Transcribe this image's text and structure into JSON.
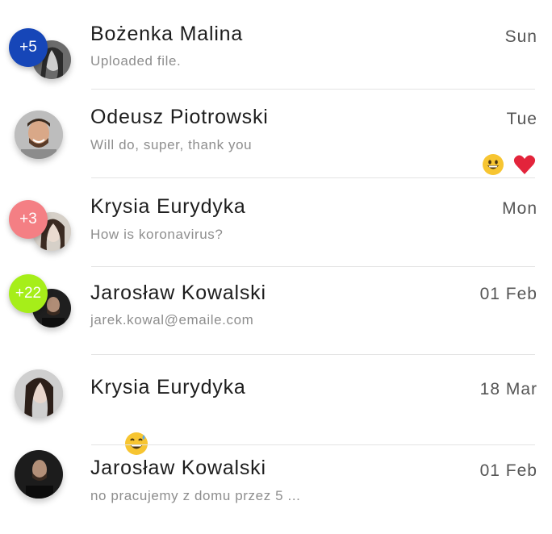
{
  "conversations": [
    {
      "name": "Bożenka Malina",
      "preview": "Uploaded file.",
      "time": "Sun",
      "badge": "+5",
      "badge_color": "#1646b8",
      "avatar": "woman-profile-avatar"
    },
    {
      "name": "Odeusz Piotrowski",
      "preview": "Will do, super, thank you",
      "time": "Tue",
      "avatar": "smiling-man-avatar",
      "reactions": [
        "grinning-face-emoji",
        "red-heart-icon"
      ]
    },
    {
      "name": "Krysia Eurydyka",
      "preview": "How is koronavirus?",
      "time": "Mon",
      "badge": "+3",
      "badge_color": "#f47f84",
      "avatar": "woman-avatar"
    },
    {
      "name": "Jarosław Kowalski",
      "preview": "jarek.kowal@emaile.com",
      "time": "01 Feb",
      "badge": "+22",
      "badge_color": "#a6ee19",
      "avatar": "man-dark-avatar"
    },
    {
      "name": "Krysia Eurydyka",
      "preview": "",
      "time": "18 Mar",
      "avatar": "woman-avatar",
      "reactions": [
        "grinning-sweat-emoji"
      ]
    },
    {
      "name": "Jarosław Kowalski",
      "preview": "no pracujemy z domu przez 5 ...",
      "time": "01 Feb",
      "avatar": "man-dark-avatar"
    }
  ]
}
